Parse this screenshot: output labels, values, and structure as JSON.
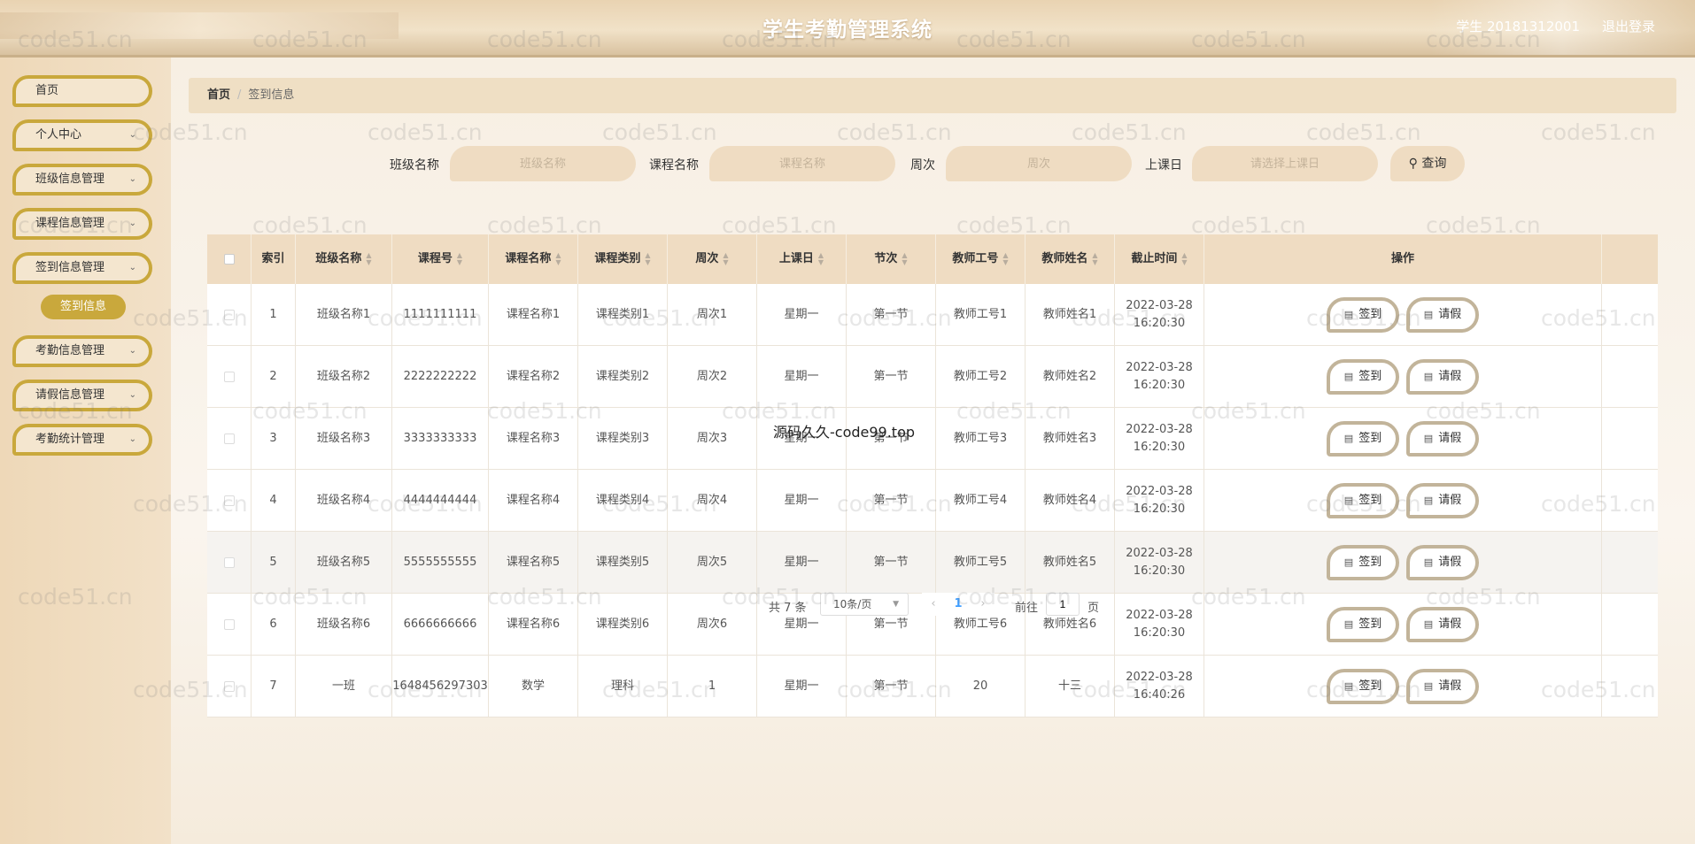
{
  "header": {
    "title": "学生考勤管理系统",
    "user": "学生 20181312001",
    "logout": "退出登录"
  },
  "sidebar": {
    "items": [
      {
        "label": "首页",
        "has_children": false
      },
      {
        "label": "个人中心",
        "has_children": true
      },
      {
        "label": "班级信息管理",
        "has_children": true
      },
      {
        "label": "课程信息管理",
        "has_children": true
      },
      {
        "label": "签到信息管理",
        "has_children": true
      },
      {
        "label": "考勤信息管理",
        "has_children": true
      },
      {
        "label": "请假信息管理",
        "has_children": true
      },
      {
        "label": "考勤统计管理",
        "has_children": true
      }
    ],
    "active_sub": "签到信息"
  },
  "breadcrumb": {
    "home": "首页",
    "current": "签到信息"
  },
  "search": {
    "class_label": "班级名称",
    "class_placeholder": "班级名称",
    "course_label": "课程名称",
    "course_placeholder": "课程名称",
    "week_label": "周次",
    "week_placeholder": "周次",
    "day_label": "上课日",
    "day_placeholder": "请选择上课日",
    "button": "查询"
  },
  "table": {
    "headers": [
      "索引",
      "班级名称",
      "课程号",
      "课程名称",
      "课程类别",
      "周次",
      "上课日",
      "节次",
      "教师工号",
      "教师姓名",
      "截止时间",
      "操作"
    ],
    "rows": [
      {
        "index": "1",
        "class": "班级名称1",
        "course_no": "1111111111",
        "course_name": "课程名称1",
        "category": "课程类别1",
        "week": "周次1",
        "day": "星期一",
        "period": "第一节",
        "teacher_no": "教师工号1",
        "teacher": "教师姓名1",
        "deadline": "2022-03-28 16:20:30"
      },
      {
        "index": "2",
        "class": "班级名称2",
        "course_no": "2222222222",
        "course_name": "课程名称2",
        "category": "课程类别2",
        "week": "周次2",
        "day": "星期一",
        "period": "第一节",
        "teacher_no": "教师工号2",
        "teacher": "教师姓名2",
        "deadline": "2022-03-28 16:20:30"
      },
      {
        "index": "3",
        "class": "班级名称3",
        "course_no": "3333333333",
        "course_name": "课程名称3",
        "category": "课程类别3",
        "week": "周次3",
        "day": "星期一",
        "period": "第一节",
        "teacher_no": "教师工号3",
        "teacher": "教师姓名3",
        "deadline": "2022-03-28 16:20:30"
      },
      {
        "index": "4",
        "class": "班级名称4",
        "course_no": "4444444444",
        "course_name": "课程名称4",
        "category": "课程类别4",
        "week": "周次4",
        "day": "星期一",
        "period": "第一节",
        "teacher_no": "教师工号4",
        "teacher": "教师姓名4",
        "deadline": "2022-03-28 16:20:30"
      },
      {
        "index": "5",
        "class": "班级名称5",
        "course_no": "5555555555",
        "course_name": "课程名称5",
        "category": "课程类别5",
        "week": "周次5",
        "day": "星期一",
        "period": "第一节",
        "teacher_no": "教师工号5",
        "teacher": "教师姓名5",
        "deadline": "2022-03-28 16:20:30"
      },
      {
        "index": "6",
        "class": "班级名称6",
        "course_no": "6666666666",
        "course_name": "课程名称6",
        "category": "课程类别6",
        "week": "周次6",
        "day": "星期一",
        "period": "第一节",
        "teacher_no": "教师工号6",
        "teacher": "教师姓名6",
        "deadline": "2022-03-28 16:20:30"
      },
      {
        "index": "7",
        "class": "一班",
        "course_no": "1648456297303",
        "course_name": "数学",
        "category": "理科",
        "week": "1",
        "day": "星期一",
        "period": "第一节",
        "teacher_no": "20",
        "teacher": "十三",
        "deadline": "2022-03-28 16:40:26"
      }
    ],
    "sign_btn": "签到",
    "leave_btn": "请假"
  },
  "pager": {
    "total": "共 7 条",
    "page_size": "10条/页",
    "current": "1",
    "goto": "前往",
    "jump_value": "1",
    "page_unit": "页"
  },
  "watermark": {
    "text": "code51.cn",
    "center": "源码久久-code99.top"
  },
  "colors": {
    "accent": "#c9a83c",
    "header_bg": "#efdcc2",
    "link": "#409eff"
  }
}
